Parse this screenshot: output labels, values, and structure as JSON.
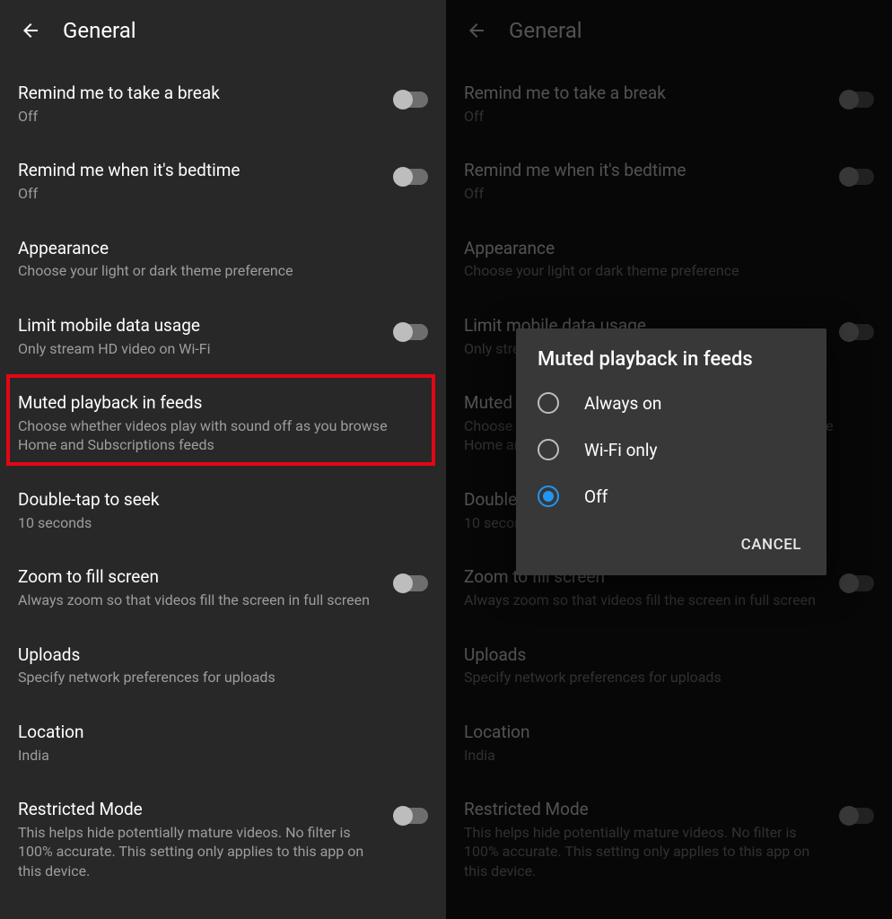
{
  "left": {
    "header": {
      "title": "General"
    },
    "items": [
      {
        "title": "Remind me to take a break",
        "sub": "Off",
        "toggle": true
      },
      {
        "title": "Remind me when it's bedtime",
        "sub": "Off",
        "toggle": true
      },
      {
        "title": "Appearance",
        "sub": "Choose your light or dark theme preference",
        "toggle": false
      },
      {
        "title": "Limit mobile data usage",
        "sub": "Only stream HD video on Wi-Fi",
        "toggle": true
      },
      {
        "title": "Muted playback in feeds",
        "sub": "Choose whether videos play with sound off as you browse Home and Subscriptions feeds",
        "toggle": false
      },
      {
        "title": "Double-tap to seek",
        "sub": "10 seconds",
        "toggle": false
      },
      {
        "title": "Zoom to fill screen",
        "sub": "Always zoom so that videos fill the screen in full screen",
        "toggle": true
      },
      {
        "title": "Uploads",
        "sub": "Specify network preferences for uploads",
        "toggle": false
      },
      {
        "title": "Location",
        "sub": "India",
        "toggle": false
      },
      {
        "title": "Restricted Mode",
        "sub": "This helps hide potentially mature videos. No filter is 100% accurate. This setting only applies to this app on this device.",
        "toggle": true
      }
    ]
  },
  "right": {
    "header": {
      "title": "General"
    },
    "items": [
      {
        "title": "Remind me to take a break",
        "sub": "Off",
        "toggle": true
      },
      {
        "title": "Remind me when it's bedtime",
        "sub": "Off",
        "toggle": true
      },
      {
        "title": "Appearance",
        "sub": "Choose your light or dark theme preference",
        "toggle": false
      },
      {
        "title": "Limit mobile data usage",
        "sub": "Only stream HD video on Wi-Fi",
        "toggle": true
      },
      {
        "title": "Muted playback in feeds",
        "sub": "Choose whether videos play with sound off as you browse Home and Subscriptions feeds",
        "toggle": false
      },
      {
        "title": "Double-tap to seek",
        "sub": "10 seconds",
        "toggle": false
      },
      {
        "title": "Zoom to fill screen",
        "sub": "Always zoom so that videos fill the screen in full screen",
        "toggle": true
      },
      {
        "title": "Uploads",
        "sub": "Specify network preferences for uploads",
        "toggle": false
      },
      {
        "title": "Location",
        "sub": "India",
        "toggle": false
      },
      {
        "title": "Restricted Mode",
        "sub": "This helps hide potentially mature videos. No filter is 100% accurate. This setting only applies to this app on this device.",
        "toggle": true
      }
    ],
    "dialog": {
      "title": "Muted playback in feeds",
      "options": [
        "Always on",
        "Wi-Fi only",
        "Off"
      ],
      "selected_index": 2,
      "cancel": "CANCEL"
    }
  }
}
